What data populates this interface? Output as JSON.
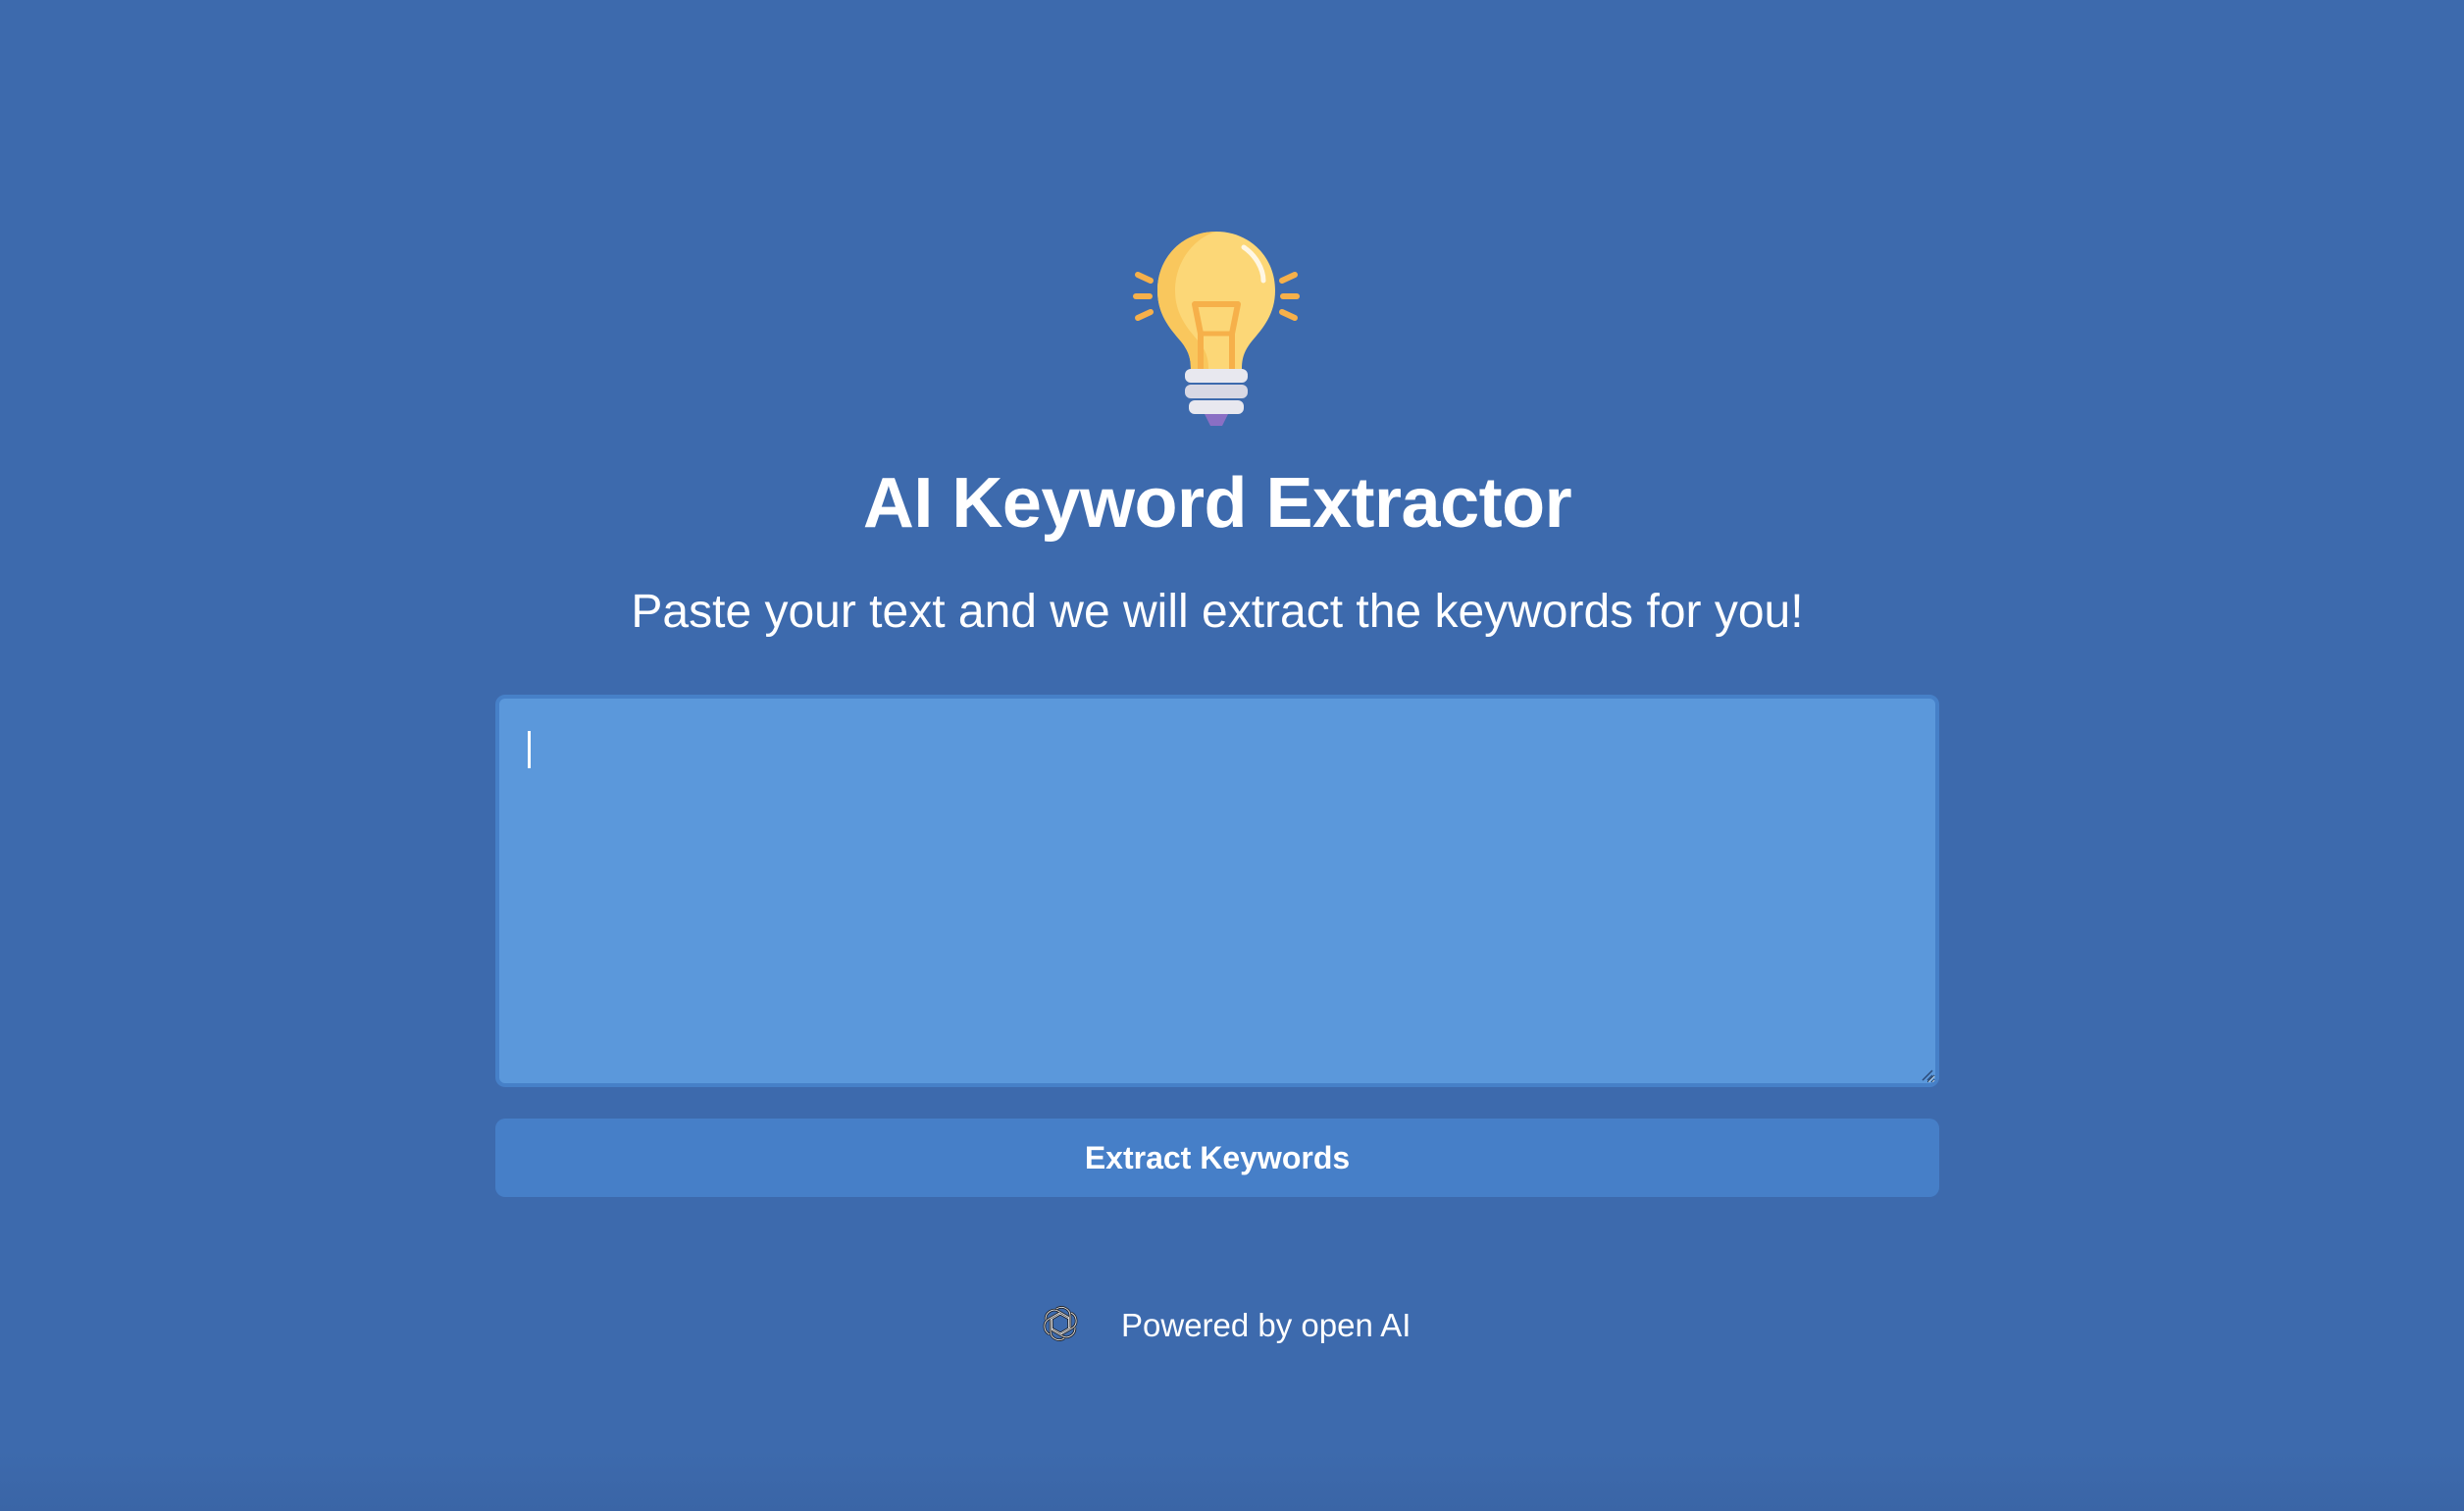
{
  "app": {
    "logo_icon": "lightbulb-icon",
    "title": "AI Keyword Extractor",
    "subtitle": "Paste your text and we will extract the keywords for you!"
  },
  "input": {
    "value": "",
    "placeholder": ""
  },
  "actions": {
    "extract_label": "Extract Keywords"
  },
  "footer": {
    "icon": "openai-icon",
    "powered_by": "Powered by open AI"
  },
  "colors": {
    "background": "#3d6aad",
    "textarea_bg": "#5b98db",
    "button_bg": "#467fc8",
    "bulb_yellow": "#fcd777"
  }
}
